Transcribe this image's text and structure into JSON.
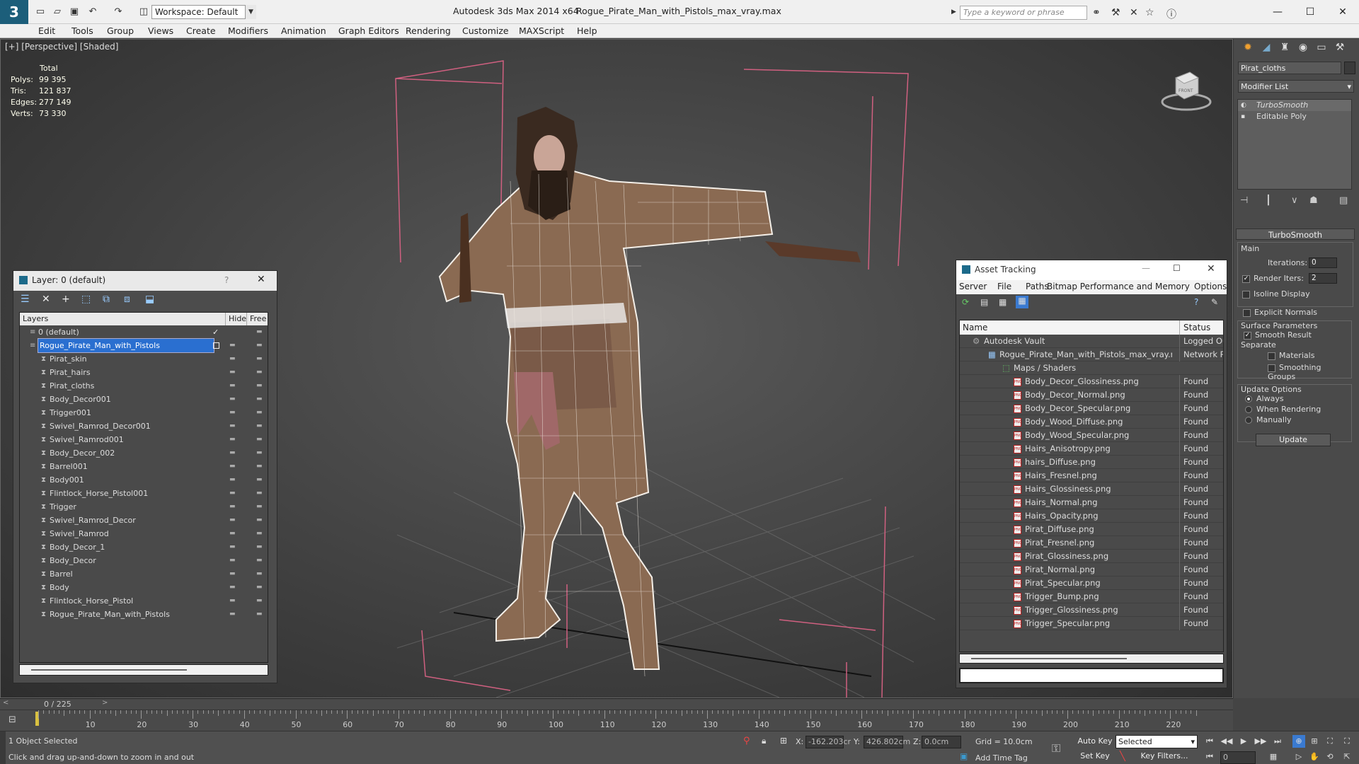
{
  "window": {
    "app_title": "Autodesk 3ds Max  2014 x64",
    "file_title": "Rogue_Pirate_Man_with_Pistols_max_vray.max",
    "workspace": "Workspace: Default",
    "search_placeholder": "Type a keyword or phrase"
  },
  "menu": [
    "Edit",
    "Tools",
    "Group",
    "Views",
    "Create",
    "Modifiers",
    "Animation",
    "Graph Editors",
    "Rendering",
    "Customize",
    "MAXScript",
    "Help"
  ],
  "viewport": {
    "label": "[+] [Perspective] [Shaded]",
    "stats": {
      "header": "Total",
      "rows": [
        {
          "k": "Polys:",
          "v": "99 395"
        },
        {
          "k": "Tris:",
          "v": "121 837"
        },
        {
          "k": "Edges:",
          "v": "277 149"
        },
        {
          "k": "Verts:",
          "v": "73 330"
        }
      ]
    },
    "viewcube_label": "FRONT"
  },
  "command_panel": {
    "object_name": "Pirat_cloths",
    "modifier_list": "Modifier List",
    "stack": [
      "TurboSmooth",
      "Editable Poly"
    ],
    "rollout_title": "TurboSmooth",
    "main_label": "Main",
    "iterations_label": "Iterations:",
    "iterations_value": "0",
    "render_iters_label": "Render Iters:",
    "render_iters_value": "2",
    "isoline": "Isoline Display",
    "explicit_normals": "Explicit Normals",
    "surface_params": "Surface Parameters",
    "smooth_result": "Smooth Result",
    "separate": "Separate",
    "materials": "Materials",
    "smoothing_groups": "Smoothing Groups",
    "update_options": "Update Options",
    "always": "Always",
    "when_rendering": "When Rendering",
    "manually": "Manually",
    "update_button": "Update"
  },
  "layer_panel": {
    "title": "Layer: 0 (default)",
    "help": "?",
    "col_layers": "Layers",
    "col_hide": "Hide",
    "col_freeze": "Free",
    "rows": [
      {
        "name": "0 (default)",
        "level": 0,
        "check": true
      },
      {
        "name": "Rogue_Pirate_Man_with_Pistols",
        "level": 0,
        "selected": true
      },
      {
        "name": "Pirat_skin",
        "level": 1
      },
      {
        "name": "Pirat_hairs",
        "level": 1
      },
      {
        "name": "Pirat_cloths",
        "level": 1
      },
      {
        "name": "Body_Decor001",
        "level": 1
      },
      {
        "name": "Trigger001",
        "level": 1
      },
      {
        "name": "Swivel_Ramrod_Decor001",
        "level": 1
      },
      {
        "name": "Swivel_Ramrod001",
        "level": 1
      },
      {
        "name": "Body_Decor_002",
        "level": 1
      },
      {
        "name": "Barrel001",
        "level": 1
      },
      {
        "name": "Body001",
        "level": 1
      },
      {
        "name": "Flintlock_Horse_Pistol001",
        "level": 1
      },
      {
        "name": "Trigger",
        "level": 1
      },
      {
        "name": "Swivel_Ramrod_Decor",
        "level": 1
      },
      {
        "name": "Swivel_Ramrod",
        "level": 1
      },
      {
        "name": "Body_Decor_1",
        "level": 1
      },
      {
        "name": "Body_Decor",
        "level": 1
      },
      {
        "name": "Barrel",
        "level": 1
      },
      {
        "name": "Body",
        "level": 1
      },
      {
        "name": "Flintlock_Horse_Pistol",
        "level": 1
      },
      {
        "name": "Rogue_Pirate_Man_with_Pistols",
        "level": 1
      }
    ]
  },
  "asset_tracking": {
    "title": "Asset Tracking",
    "menu": [
      "Server",
      "File",
      "Paths",
      "Bitmap Performance and Memory",
      "Options"
    ],
    "col_name": "Name",
    "col_status": "Status",
    "rows": [
      {
        "name": "Autodesk Vault",
        "status": "Logged Out",
        "level": 0
      },
      {
        "name": "Rogue_Pirate_Man_with_Pistols_max_vray.max",
        "status": "Network Path",
        "level": 1
      },
      {
        "name": "Maps / Shaders",
        "status": "",
        "level": 2
      },
      {
        "name": "Body_Decor_Glossiness.png",
        "status": "Found",
        "level": 3
      },
      {
        "name": "Body_Decor_Normal.png",
        "status": "Found",
        "level": 3
      },
      {
        "name": "Body_Decor_Specular.png",
        "status": "Found",
        "level": 3
      },
      {
        "name": "Body_Wood_Diffuse.png",
        "status": "Found",
        "level": 3
      },
      {
        "name": "Body_Wood_Specular.png",
        "status": "Found",
        "level": 3
      },
      {
        "name": "Hairs_Anisotropy.png",
        "status": "Found",
        "level": 3
      },
      {
        "name": "hairs_Diffuse.png",
        "status": "Found",
        "level": 3
      },
      {
        "name": "Hairs_Fresnel.png",
        "status": "Found",
        "level": 3
      },
      {
        "name": "Hairs_Glossiness.png",
        "status": "Found",
        "level": 3
      },
      {
        "name": "Hairs_Normal.png",
        "status": "Found",
        "level": 3
      },
      {
        "name": "Hairs_Opacity.png",
        "status": "Found",
        "level": 3
      },
      {
        "name": "Pirat_Diffuse.png",
        "status": "Found",
        "level": 3
      },
      {
        "name": "Pirat_Fresnel.png",
        "status": "Found",
        "level": 3
      },
      {
        "name": "Pirat_Glossiness.png",
        "status": "Found",
        "level": 3
      },
      {
        "name": "Pirat_Normal.png",
        "status": "Found",
        "level": 3
      },
      {
        "name": "Pirat_Specular.png",
        "status": "Found",
        "level": 3
      },
      {
        "name": "Trigger_Bump.png",
        "status": "Found",
        "level": 3
      },
      {
        "name": "Trigger_Glossiness.png",
        "status": "Found",
        "level": 3
      },
      {
        "name": "Trigger_Specular.png",
        "status": "Found",
        "level": 3
      }
    ]
  },
  "timeline": {
    "frame": "0 / 225",
    "ticks": [
      "10",
      "20",
      "30",
      "40",
      "50",
      "60",
      "70",
      "80",
      "90",
      "100",
      "110",
      "120",
      "130",
      "140",
      "150",
      "160",
      "170",
      "180",
      "190",
      "200",
      "210",
      "220"
    ]
  },
  "status": {
    "selection": "1 Object Selected",
    "prompt": "Click and drag up-and-down to zoom in and out",
    "x_label": "X:",
    "x_value": "-162.203cr",
    "y_label": "Y:",
    "y_value": "426.802cm",
    "z_label": "Z:",
    "z_value": "0.0cm",
    "grid": "Grid = 10.0cm",
    "auto_key": "Auto Key",
    "selected": "Selected",
    "set_key": "Set Key",
    "key_filters": "Key Filters...",
    "add_time_tag": "Add Time Tag",
    "frame_field": "0"
  }
}
